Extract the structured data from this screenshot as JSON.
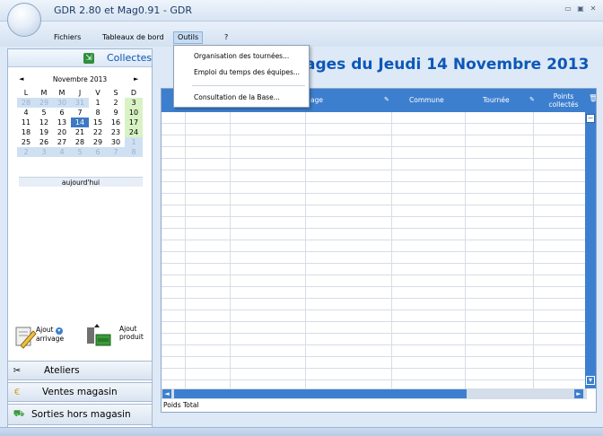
{
  "window": {
    "title": "GDR 2.80 et Mag0.91 - GDR"
  },
  "menu": {
    "items": [
      "Fichiers",
      "Tableaux de bord",
      "Outils",
      "?"
    ],
    "active": "Outils"
  },
  "dropdown": {
    "items": [
      "Organisation des tournées...",
      "Emploi du temps des équipes...",
      "Consultation de la Base..."
    ]
  },
  "left_panel": {
    "title": "Collectes",
    "calendar": {
      "month": "Novembre 2013",
      "prev": "◄",
      "next": "►",
      "weekdays": [
        "L",
        "M",
        "M",
        "J",
        "V",
        "S",
        "D"
      ],
      "days": [
        "28",
        "29",
        "30",
        "31",
        "1",
        "2",
        "3",
        "4",
        "5",
        "6",
        "7",
        "8",
        "9",
        "10",
        "11",
        "12",
        "13",
        "14",
        "15",
        "16",
        "17",
        "18",
        "19",
        "20",
        "21",
        "22",
        "23",
        "24",
        "25",
        "26",
        "27",
        "28",
        "29",
        "30",
        "1",
        "2",
        "3",
        "4",
        "5",
        "6",
        "7",
        "8"
      ],
      "today_label": "aujourd'hui",
      "selected": "14"
    },
    "quick_actions": [
      {
        "label_line1": "Ajout",
        "label_line2": "arrivage"
      },
      {
        "label_line1": "Ajout",
        "label_line2": "produit"
      }
    ]
  },
  "accordion": [
    "Ateliers",
    "Ventes magasin",
    "Sorties hors magasin"
  ],
  "main": {
    "title": "ages du Jeudi 14 Novembre 2013",
    "columns": [
      "age",
      "Commune",
      "Tournée",
      "Points collectés"
    ],
    "footer": "Poids Total"
  }
}
